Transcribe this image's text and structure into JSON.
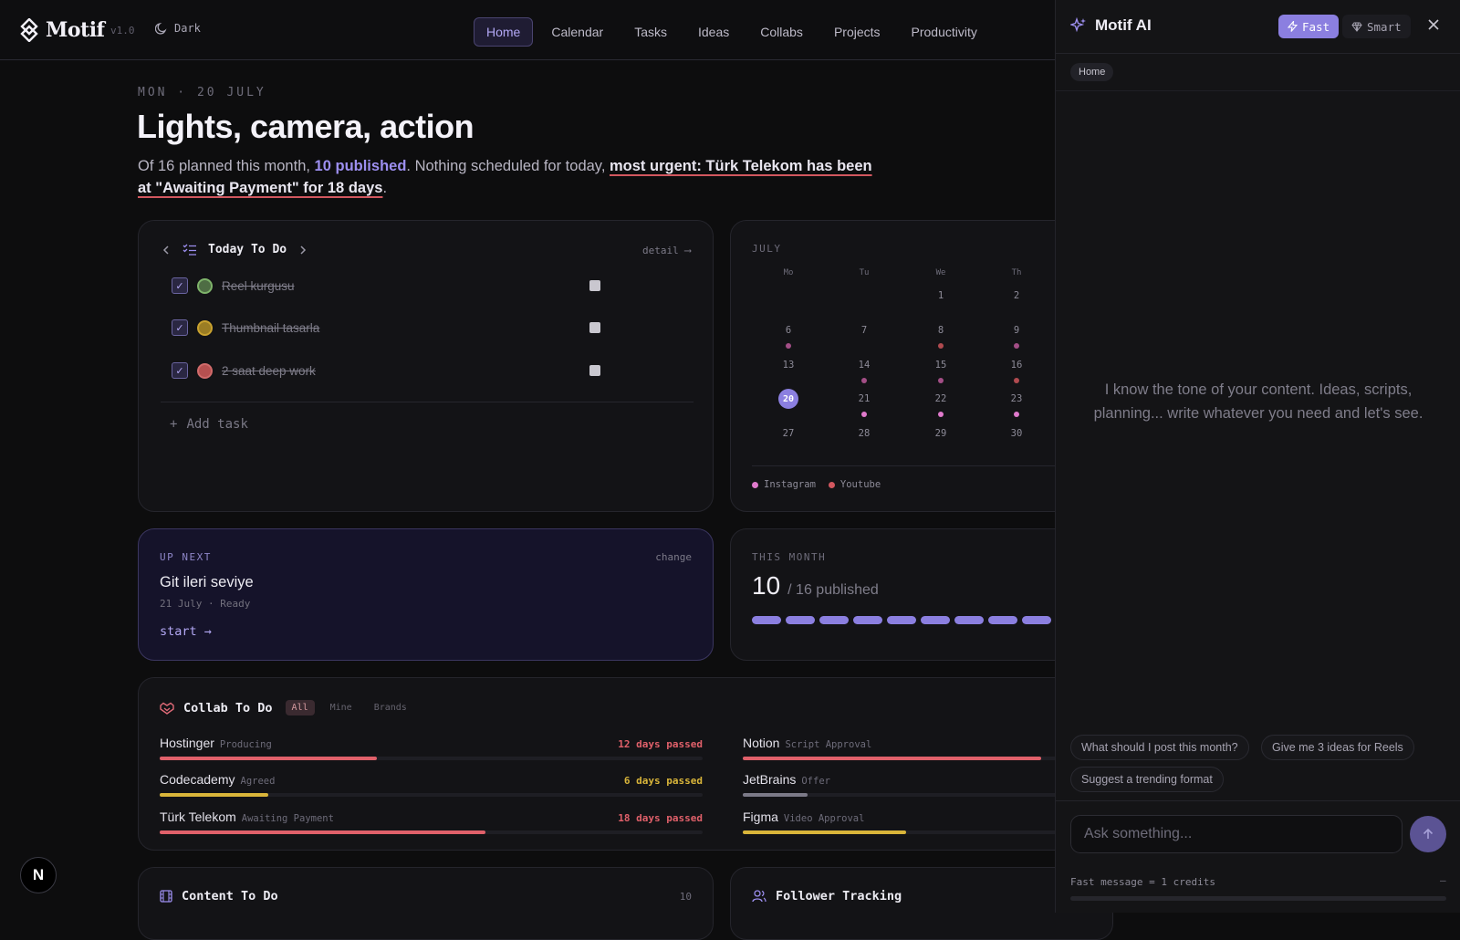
{
  "app": {
    "name": "Motif",
    "version": "v1.0",
    "theme_label": "Dark"
  },
  "nav": {
    "items": [
      "Home",
      "Calendar",
      "Tasks",
      "Ideas",
      "Collabs",
      "Projects",
      "Productivity"
    ],
    "active": "Home"
  },
  "hero": {
    "date": "MON · 20 JULY",
    "title": "Lights, camera, action",
    "summary_prefix": "Of 16 planned this month, ",
    "summary_published": "10 published",
    "summary_middle": ". Nothing scheduled for today, ",
    "summary_urgent": "most urgent: Türk Telekom has been at \"Awaiting Payment\" for 18 days",
    "summary_suffix": "."
  },
  "today_todo": {
    "title": "Today To Do",
    "detail_link": "detail ⟶",
    "tasks": [
      {
        "label": "Reel kurgusu",
        "done": true,
        "color": "#7eb36a"
      },
      {
        "label": "Thumbnail tasarla",
        "done": true,
        "color": "#c9a22f"
      },
      {
        "label": "2 saat deep work",
        "done": true,
        "color": "#d06a6a"
      }
    ],
    "add_task": "Add task"
  },
  "calendar": {
    "month": "JULY",
    "weekdays": [
      "Mo",
      "Tu",
      "We",
      "Th"
    ],
    "rows": [
      [
        "",
        "",
        "1",
        "2"
      ],
      [
        "6",
        "7",
        "8",
        "9"
      ],
      [
        "13",
        "14",
        "15",
        "16"
      ],
      [
        "20",
        "21",
        "22",
        "23"
      ],
      [
        "27",
        "28",
        "29",
        "30"
      ]
    ],
    "today": "20",
    "dots": {
      "6": "#a34e86",
      "8": "#b04a4f",
      "9": "#a34e86",
      "14": "#a34e86",
      "15": "#a34e86",
      "16": "#b04a4f",
      "21": "#e07acc",
      "22": "#e07acc",
      "23": "#e07acc"
    },
    "legend": [
      {
        "label": "Instagram",
        "color": "#e07acc"
      },
      {
        "label": "Youtube",
        "color": "#d2575f"
      }
    ]
  },
  "up_next": {
    "eyebrow": "UP NEXT",
    "change": "change",
    "title": "Git ileri seviye",
    "meta": "21 July · Ready",
    "start": "start →"
  },
  "this_month": {
    "eyebrow": "THIS MONTH",
    "published": "10",
    "total_label": "/ 16 published",
    "published_count": 10,
    "planned_count": 16
  },
  "collab": {
    "title": "Collab To Do",
    "filters": [
      "All",
      "Mine",
      "Brands"
    ],
    "active_filter": "All",
    "items": [
      {
        "name": "Hostinger",
        "status": "Producing",
        "days": "12 days passed",
        "color": "#e0606a",
        "progress": 0.4
      },
      {
        "name": "Codecademy",
        "status": "Agreed",
        "days": "6 days passed",
        "color": "#d9b53a",
        "progress": 0.2
      },
      {
        "name": "Türk Telekom",
        "status": "Awaiting Payment",
        "days": "18 days passed",
        "color": "#e0606a",
        "progress": 0.6
      },
      {
        "name": "Notion",
        "status": "Script Approval",
        "days": "",
        "color": "#e0606a",
        "progress": 0.55
      },
      {
        "name": "JetBrains",
        "status": "Offer",
        "days": "",
        "color": "#7c7a88",
        "progress": 0.12
      },
      {
        "name": "Figma",
        "status": "Video Approval",
        "days": "",
        "color": "#d9b53a",
        "progress": 0.3
      }
    ]
  },
  "content_todo": {
    "title": "Content To Do",
    "count": "10"
  },
  "follower_tracking": {
    "title": "Follower Tracking"
  },
  "ai": {
    "title": "Motif AI",
    "mode_fast": "Fast",
    "mode_smart": "Smart",
    "context": "Home",
    "empty_text": "I know the tone of your content. Ideas, scripts, planning... write whatever you need and let's see.",
    "suggestions": [
      "What should I post this month?",
      "Give me 3 ideas for Reels",
      "Suggest a trending format"
    ],
    "input_placeholder": "Ask something...",
    "footer": "Fast message = 1 credits",
    "footer_dash": "–"
  },
  "badge": "N"
}
